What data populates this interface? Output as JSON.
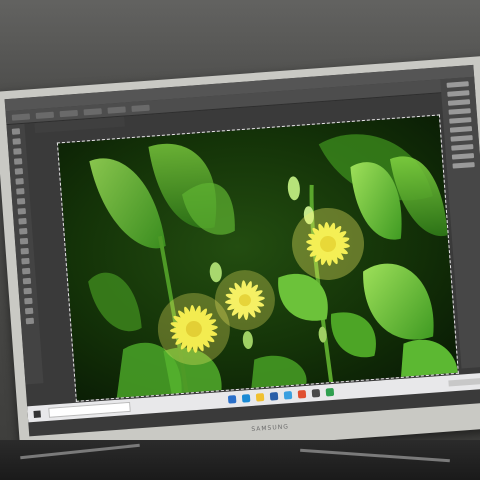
{
  "scene": {
    "description_tags": [
      "monitor-photo",
      "photoshop-window",
      "yellow-flowers",
      "green-leaves"
    ]
  },
  "app": {
    "menu_items": [
      "",
      "",
      "",
      "",
      "",
      "",
      "",
      "",
      "",
      "",
      "",
      ""
    ]
  },
  "monitor": {
    "brand": "SAMSUNG"
  },
  "colors": {
    "leaf": "#4fae2c",
    "leaf_light": "#8fd84a",
    "flower": "#f4ef55",
    "background_dark": "#0f2a08",
    "ui_dark": "#3a3a3a"
  }
}
